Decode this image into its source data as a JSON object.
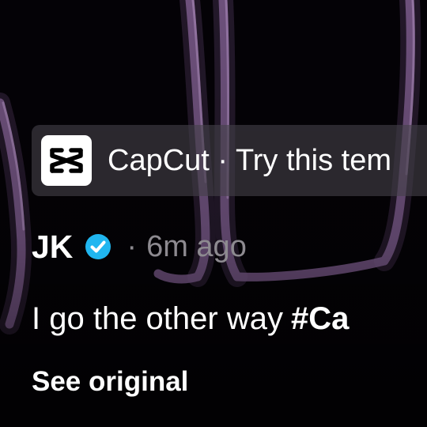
{
  "banner": {
    "app_name": "CapCut",
    "separator": "·",
    "cta_text": "Try this tem",
    "logo_icon": "capcut-logo-icon"
  },
  "author": {
    "name": "JK",
    "verified_icon": "verified-badge-icon",
    "separator": "·",
    "time_ago": "6m ago"
  },
  "caption": {
    "text": "I go the other way",
    "hashtag": "#Ca"
  },
  "see_original": "See original",
  "colors": {
    "background": "#040206",
    "verified": "#20b6f0",
    "secondary_text": "#8d8a90",
    "art_stroke": "#7a5a8a"
  }
}
